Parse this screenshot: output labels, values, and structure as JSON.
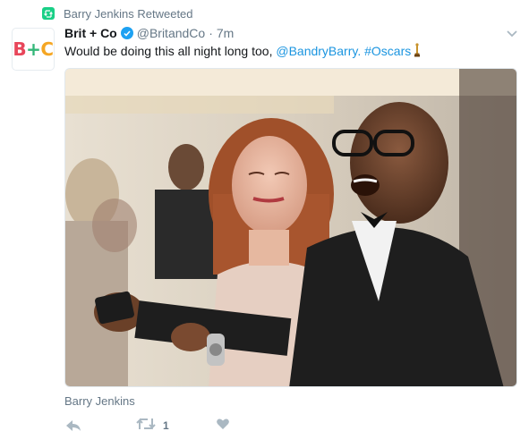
{
  "retweet_context": {
    "icon": "retweet-icon",
    "text": "Barry Jenkins Retweeted",
    "icon_color": "#19cf86"
  },
  "tweet": {
    "avatar": {
      "b": "B",
      "plus": "+",
      "c": "C"
    },
    "fullname": "Brit + Co",
    "verified": true,
    "handle": "@BritandCo",
    "separator": "·",
    "time": "7m",
    "text_before": "Would be doing this all night long too, ",
    "mention": "@BandryBarry.",
    "hashtag": "#Oscars",
    "media_tagged_user": "Barry Jenkins",
    "actions": {
      "reply_icon": "reply-icon",
      "retweet_icon": "retweet-icon",
      "retweet_count": "1",
      "like_icon": "heart-icon"
    }
  },
  "colors": {
    "link": "#1b95e0",
    "muted": "#657786",
    "verified": "#1da1f2"
  }
}
